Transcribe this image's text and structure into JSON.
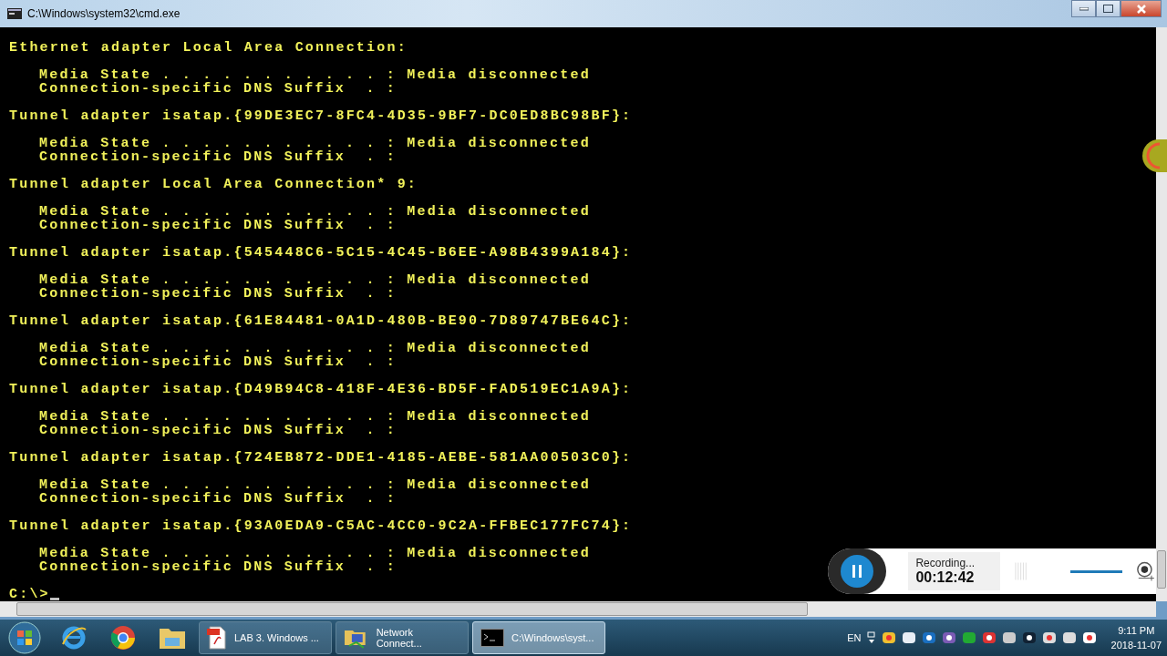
{
  "window": {
    "title": "C:\\Windows\\system32\\cmd.exe"
  },
  "console": {
    "blocks": [
      {
        "header": "Ethernet adapter Local Area Connection:",
        "fields": [
          "Media State . . . . . . . . . . . : Media disconnected",
          "Connection-specific DNS Suffix  . :"
        ]
      },
      {
        "header": "Tunnel adapter isatap.{99DE3EC7-8FC4-4D35-9BF7-DC0ED8BC98BF}:",
        "fields": [
          "Media State . . . . . . . . . . . : Media disconnected",
          "Connection-specific DNS Suffix  . :"
        ]
      },
      {
        "header": "Tunnel adapter Local Area Connection* 9:",
        "fields": [
          "Media State . . . . . . . . . . . : Media disconnected",
          "Connection-specific DNS Suffix  . :"
        ]
      },
      {
        "header": "Tunnel adapter isatap.{545448C6-5C15-4C45-B6EE-A98B4399A184}:",
        "fields": [
          "Media State . . . . . . . . . . . : Media disconnected",
          "Connection-specific DNS Suffix  . :"
        ]
      },
      {
        "header": "Tunnel adapter isatap.{61E84481-0A1D-480B-BE90-7D89747BE64C}:",
        "fields": [
          "Media State . . . . . . . . . . . : Media disconnected",
          "Connection-specific DNS Suffix  . :"
        ]
      },
      {
        "header": "Tunnel adapter isatap.{D49B94C8-418F-4E36-BD5F-FAD519EC1A9A}:",
        "fields": [
          "Media State . . . . . . . . . . . : Media disconnected",
          "Connection-specific DNS Suffix  . :"
        ]
      },
      {
        "header": "Tunnel adapter isatap.{724EB872-DDE1-4185-AEBE-581AA00503C0}:",
        "fields": [
          "Media State . . . . . . . . . . . : Media disconnected",
          "Connection-specific DNS Suffix  . :"
        ]
      },
      {
        "header": "Tunnel adapter isatap.{93A0EDA9-C5AC-4CC0-9C2A-FFBEC177FC74}:",
        "fields": [
          "Media State . . . . . . . . . . . : Media disconnected",
          "Connection-specific DNS Suffix  . :"
        ]
      }
    ],
    "prompt": "C:\\>"
  },
  "recorder": {
    "status": "Recording...",
    "time": "00:12:42",
    "level": 1
  },
  "taskbar": {
    "tasks": [
      {
        "label": "LAB 3.  Windows ...",
        "kind": "pdf",
        "selected": false
      },
      {
        "label": "Network Connect...",
        "kind": "network",
        "selected": false
      },
      {
        "label": "C:\\Windows\\syst...",
        "kind": "cmd",
        "selected": true
      }
    ],
    "language": "EN",
    "time": "9:11 PM",
    "date": "2018-11-07"
  }
}
